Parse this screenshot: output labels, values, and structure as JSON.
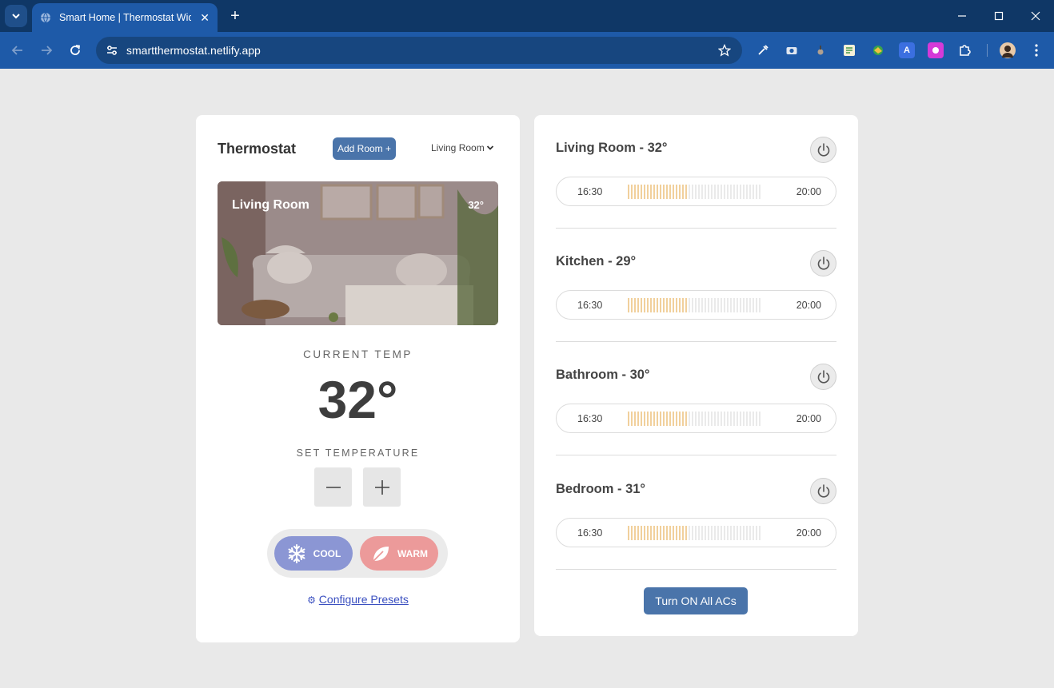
{
  "browser": {
    "tab_title": "Smart Home | Thermostat Widget",
    "url": "smartthermostat.netlify.app"
  },
  "thermostat": {
    "title": "Thermostat",
    "add_room_label": "Add Room +",
    "room_select": "Living Room",
    "image": {
      "room_label": "Living Room",
      "temp": "32°"
    },
    "current_temp_label": "CURRENT TEMP",
    "current_temp": "32°",
    "set_temp_label": "SET TEMPERATURE",
    "modes": {
      "cool": "COOL",
      "warm": "WARM"
    },
    "presets_link": "Configure Presets"
  },
  "acs": {
    "rooms": [
      {
        "name": "Living Room - 32°",
        "start": "16:30",
        "end": "20:00",
        "progress": 0.46
      },
      {
        "name": "Kitchen - 29°",
        "start": "16:30",
        "end": "20:00",
        "progress": 0.46
      },
      {
        "name": "Bathroom - 30°",
        "start": "16:30",
        "end": "20:00",
        "progress": 0.46
      },
      {
        "name": "Bedroom - 31°",
        "start": "16:30",
        "end": "20:00",
        "progress": 0.46
      }
    ],
    "turn_on_all_label": "Turn ON All ACs"
  },
  "colors": {
    "accent": "#4a74aa",
    "timeline_active": "#e3a23a",
    "timeline_inactive": "#d6d6d6",
    "cool": "#8b96d4",
    "warm": "#ec9a9a"
  }
}
